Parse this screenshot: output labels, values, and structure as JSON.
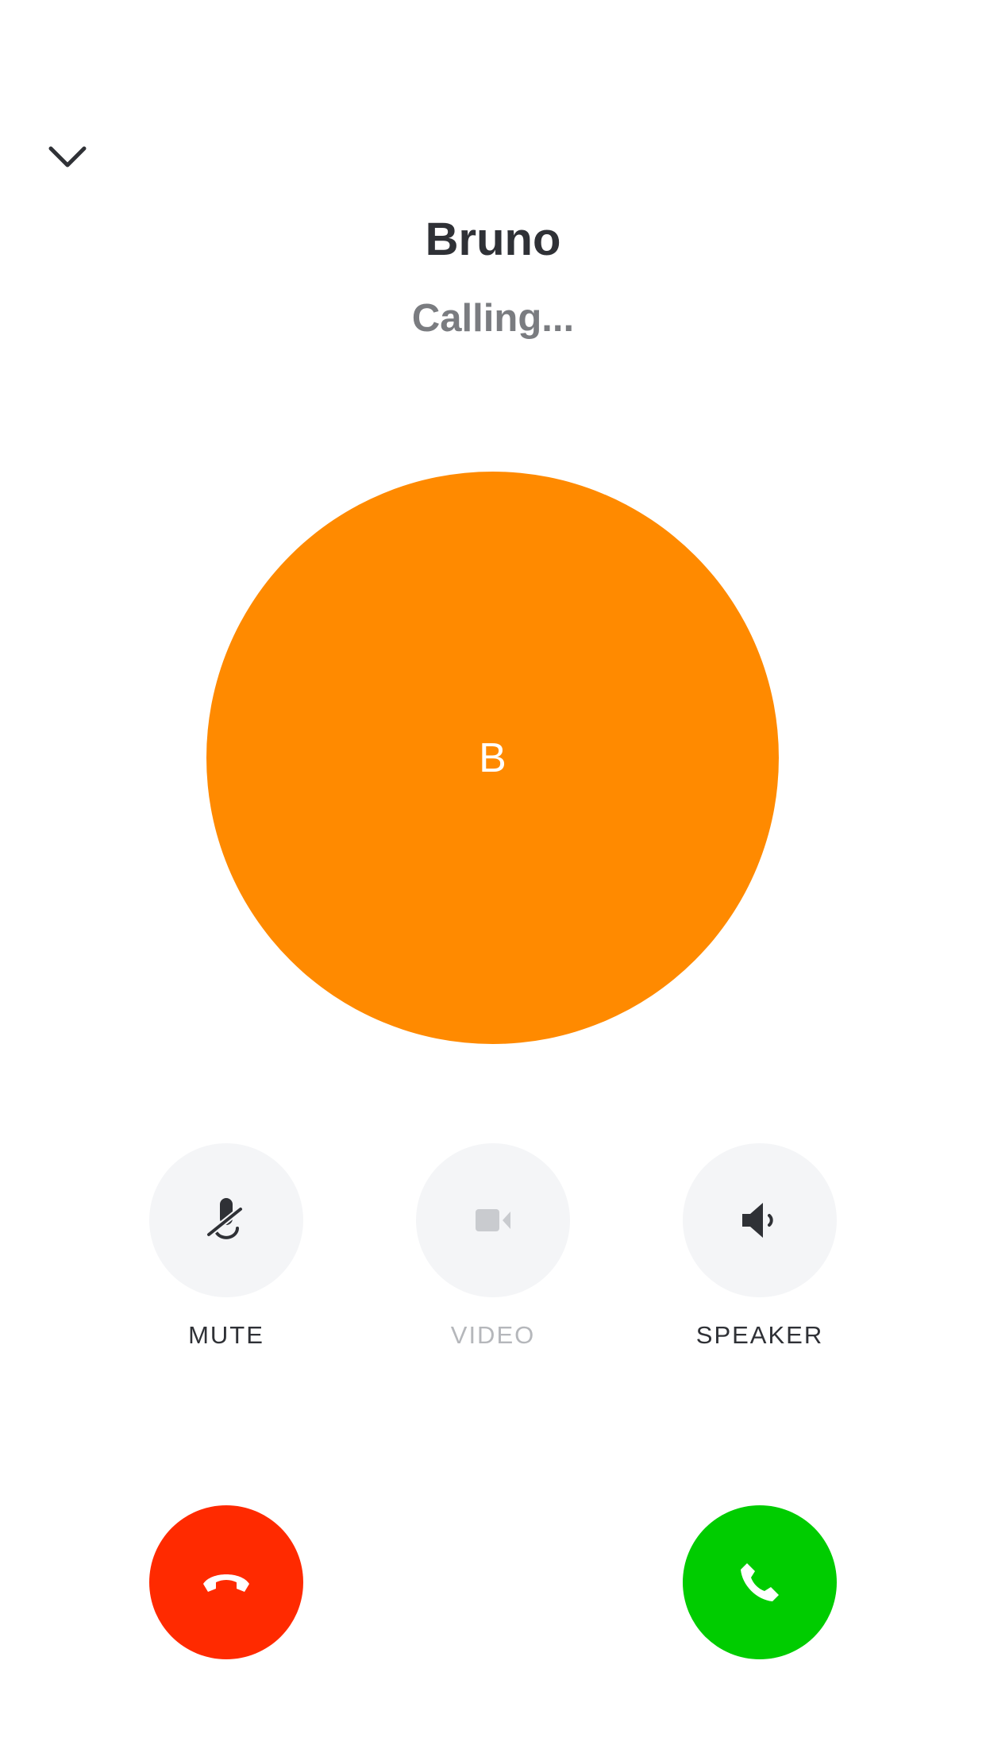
{
  "header": {
    "collapse_icon": "chevron-down-icon"
  },
  "caller": {
    "name": "Bruno",
    "status": "Calling...",
    "avatar_initial": "B",
    "avatar_color": "#ff8a00"
  },
  "controls": [
    {
      "label": "MUTE",
      "icon": "mic-off-icon",
      "enabled": true
    },
    {
      "label": "VIDEO",
      "icon": "video-camera-icon",
      "enabled": false
    },
    {
      "label": "SPEAKER",
      "icon": "speaker-icon",
      "enabled": true
    }
  ],
  "actions": {
    "decline": {
      "icon": "phone-hangup-icon",
      "color": "#ff2a00"
    },
    "accept": {
      "icon": "phone-icon",
      "color": "#00cc00"
    }
  }
}
